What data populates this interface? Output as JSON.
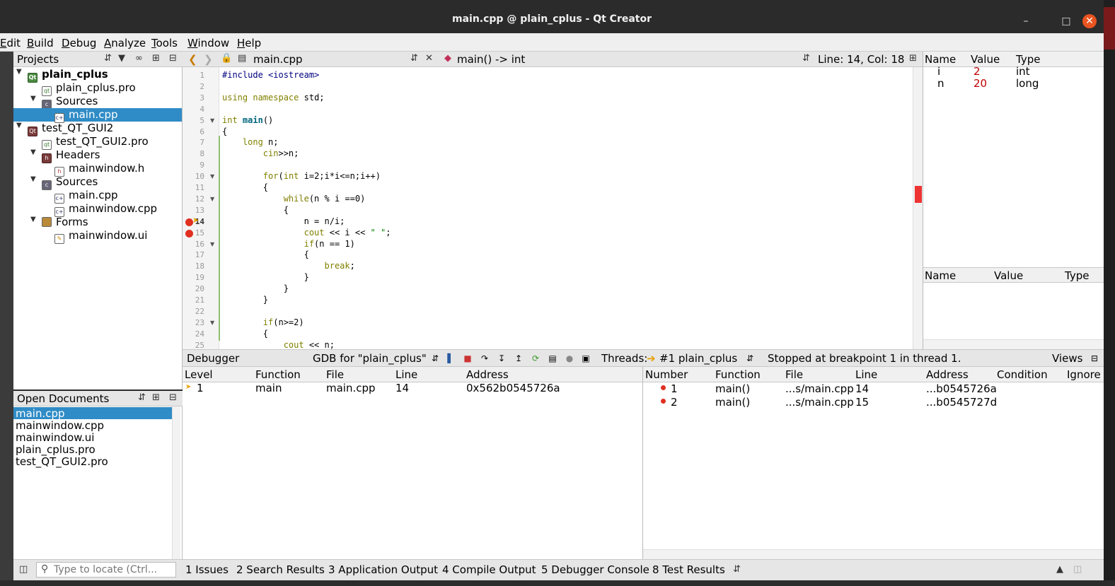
{
  "window": {
    "title": "main.cpp @ plain_cplus - Qt Creator"
  },
  "menubar": [
    "Edit",
    "Build",
    "Debug",
    "Analyze",
    "Tools",
    "Window",
    "Help"
  ],
  "projects": {
    "header": "Projects",
    "tree": [
      {
        "label": "plain_cplus",
        "bold": true
      },
      {
        "label": "plain_cplus.pro"
      },
      {
        "label": "Sources"
      },
      {
        "label": "main.cpp",
        "selected": true
      },
      {
        "label": "test_QT_GUI2"
      },
      {
        "label": "test_QT_GUI2.pro"
      },
      {
        "label": "Headers"
      },
      {
        "label": "mainwindow.h"
      },
      {
        "label": "Sources"
      },
      {
        "label": "main.cpp"
      },
      {
        "label": "mainwindow.cpp"
      },
      {
        "label": "Forms"
      },
      {
        "label": "mainwindow.ui"
      }
    ]
  },
  "open_documents": {
    "header": "Open Documents",
    "items": [
      "main.cpp",
      "mainwindow.cpp",
      "mainwindow.ui",
      "plain_cplus.pro",
      "test_QT_GUI2.pro"
    ]
  },
  "editor": {
    "file": "main.cpp",
    "symbol": "main() -> int",
    "position": "Line: 14, Col: 18",
    "line_numbers": [
      "1",
      "2",
      "3",
      "4",
      "5",
      "6",
      "7",
      "8",
      "9",
      "10",
      "11",
      "12",
      "13",
      "14",
      "15",
      "16",
      "17",
      "18",
      "19",
      "20",
      "21",
      "22",
      "23",
      "24",
      "25"
    ],
    "current_line": "14",
    "code": [
      "#include <iostream>",
      "",
      "using namespace std;",
      "",
      "int main()",
      "{",
      "    long n;",
      "        cin>>n;",
      "",
      "        for(int i=2;i*i<=n;i++)",
      "        {",
      "            while(n % i ==0)",
      "            {",
      "                n = n/i;",
      "                cout << i << \" \";",
      "                if(n == 1)",
      "                {",
      "                    break;",
      "                }",
      "            }",
      "        }",
      "",
      "        if(n>=2)",
      "        {",
      "            cout << n;"
    ]
  },
  "locals": {
    "headers": [
      "Name",
      "Value",
      "Type"
    ],
    "rows": [
      {
        "name": "i",
        "value": "2",
        "type": "int"
      },
      {
        "name": "n",
        "value": "20",
        "type": "long"
      }
    ],
    "watch_headers": [
      "Name",
      "Value",
      "Type"
    ]
  },
  "debugger_bar": {
    "label": "Debugger",
    "engine": "GDB for \"plain_cplus\"",
    "threads_label": "Threads:",
    "thread": "#1 plain_cplus",
    "status": "Stopped at breakpoint 1 in thread 1.",
    "views": "Views"
  },
  "stack": {
    "headers": [
      "Level",
      "Function",
      "File",
      "Line",
      "Address"
    ],
    "rows": [
      {
        "level": "1",
        "function": "main",
        "file": "main.cpp",
        "line": "14",
        "address": "0x562b0545726a"
      }
    ]
  },
  "breakpoints": {
    "headers": [
      "Number",
      "Function",
      "File",
      "Line",
      "Address",
      "Condition",
      "Ignore"
    ],
    "rows": [
      {
        "number": "1",
        "function": "main()",
        "file": "...s/main.cpp",
        "line": "14",
        "address": "...b0545726a"
      },
      {
        "number": "2",
        "function": "main()",
        "file": "...s/main.cpp",
        "line": "15",
        "address": "...b0545727d"
      }
    ]
  },
  "statusbar": {
    "locator_placeholder": "Type to locate (Ctrl...",
    "panes": [
      "1  Issues",
      "2  Search Results",
      "3  Application Output",
      "4  Compile Output",
      "5  Debugger Console",
      "8  Test Results"
    ]
  },
  "colors": {
    "selection": "#308cc6",
    "breakpoint": "#e03020",
    "value_changed": "#c00000",
    "titlebar": "#2b2b2b",
    "close": "#e95420"
  }
}
